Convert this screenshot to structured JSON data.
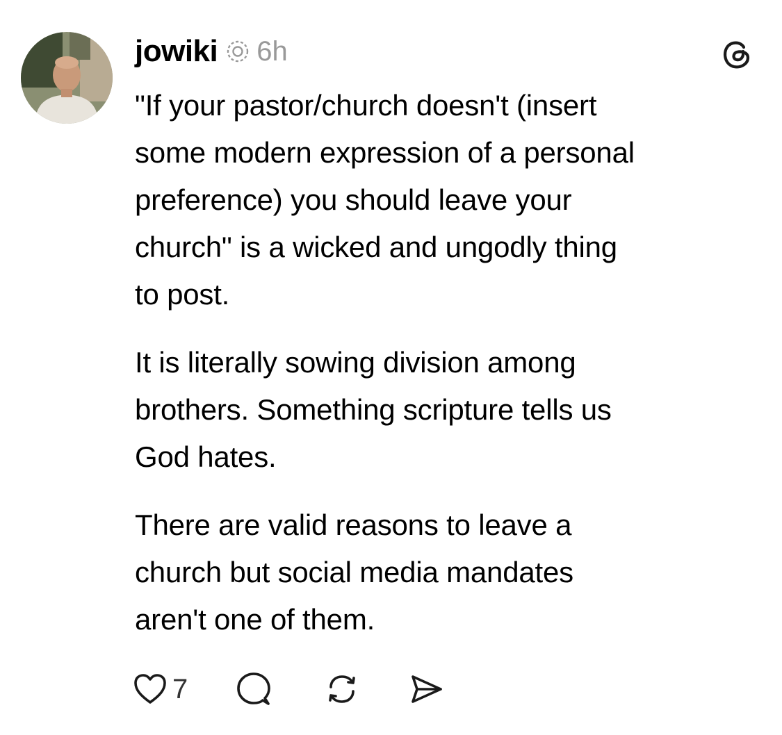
{
  "post": {
    "username": "jowiki",
    "timestamp": "6h",
    "paragraphs": [
      "\"If your pastor/church doesn't (insert\nsome modern expression of a personal\npreference) you should leave your\nchurch\" is a wicked and ungodly thing\nto post.",
      "It is literally sowing division among\nbrothers. Something scripture tells us\nGod hates.",
      "There are valid reasons to leave a\nchurch but social media mandates\naren't one of them."
    ],
    "like_count": "7"
  },
  "icons": {
    "verified": "verified-icon",
    "app_logo": "threads-logo-icon",
    "like": "heart-icon",
    "reply": "comment-icon",
    "repost": "repost-icon",
    "share": "send-icon"
  },
  "colors": {
    "text": "#000000",
    "muted": "#999999",
    "icon": "#1a1a1a"
  }
}
